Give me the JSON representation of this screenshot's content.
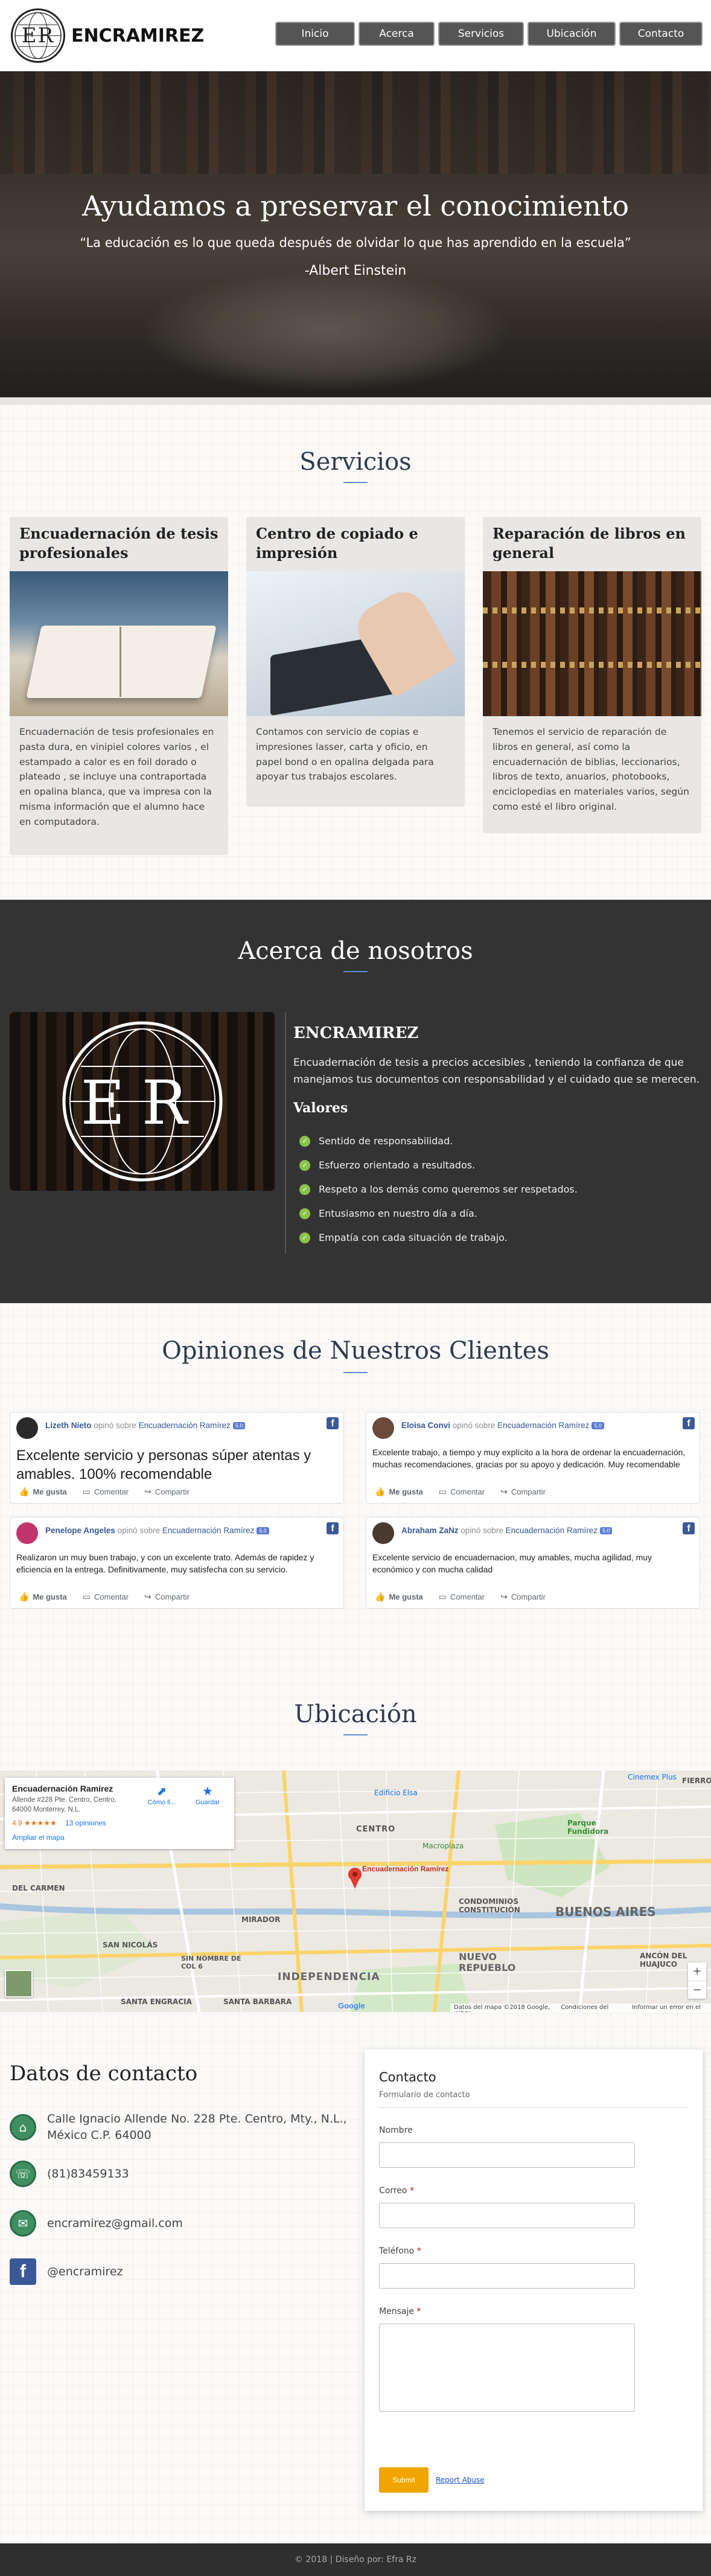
{
  "header": {
    "logo_text": "ER",
    "brand": "ENCRAMIREZ",
    "nav": [
      "Inicio",
      "Acerca",
      "Servicios",
      "Ubicación",
      "Contacto"
    ]
  },
  "hero": {
    "title": "Ayudamos a preservar el conocimiento",
    "quote": "“La educación es lo que queda después de olvidar lo que has aprendido en la escuela”",
    "author": "-Albert Einstein"
  },
  "services": {
    "title": "Servicios",
    "cards": [
      {
        "title": "Encuadernación de tesis profesionales",
        "text": "Encuadernación de tesis profesionales en pasta dura, en vinipiel colores varios , el estampado a calor es en foil dorado o plateado , se incluye una contraportada en opalina blanca, que va impresa con la misma información que el alumno hace en computadora."
      },
      {
        "title": "Centro de copiado e impresión",
        "text": "Contamos con servicio de copias e impresiones lasser, carta y oficio, en papel bond o en opalina delgada para apoyar tus trabajos escolares."
      },
      {
        "title": "Reparación de libros en general",
        "text": "Tenemos el servicio de reparación de libros en general, así como la encuadernación de biblias, leccionarios, libros de texto, anuarios, photobooks, enciclopedias en materiales varios, según como esté el libro original."
      }
    ]
  },
  "about": {
    "title": "Acerca de nosotros",
    "logo_text": "ER",
    "brand": "ENCRAMIREZ",
    "description": "Encuadernación de tesis a precios accesibles , teniendo la confianza de que manejamos tus documentos con responsabilidad y el cuidado que se merecen.",
    "values_title": "Valores",
    "values": [
      "Sentido de responsabilidad.",
      "Esfuerzo orientado a resultados.",
      "Respeto a los demás como queremos ser respetados.",
      "Entusiasmo en nuestro día a día.",
      "Empatía con cada situación de trabajo."
    ]
  },
  "opinions": {
    "title": "Opiniones de Nuestros Clientes",
    "verb": "opinó sobre",
    "page": "Encuadernación Ramírez",
    "badge": "5.0",
    "fb_icon": "f",
    "actions": [
      "Me gusta",
      "Comentar",
      "Compartir"
    ],
    "reviews": [
      {
        "name": "Lizeth Nieto",
        "text": "Excelente servicio y personas súper atentas y amables. 100% recomendable",
        "avatar_color": "#2a2a2a"
      },
      {
        "name": "Eloisa Convi",
        "text": "Excelente trabajo, a tiempo y muy explícito a la hora de ordenar la encuadernación, muchas recomendaciones, gracias por su apoyo y dedicación. Muy recomendable",
        "avatar_color": "#6b4a3a"
      },
      {
        "name": "Penelope Angeles",
        "text": "Realizaron un muy buen trabajo, y con un excelente trato. Además de rapidez y eficiencia en la entrega. Definitivamente, muy satisfecha con su servicio.",
        "avatar_color": "#c0356a"
      },
      {
        "name": "Abraham ZaNz",
        "text": "Excelente servicio de encuadernacion, muy amables, mucha agilidad, muy económico y con mucha calidad",
        "avatar_color": "#4a3a30"
      }
    ]
  },
  "location": {
    "title": "Ubicación",
    "place_name": "Encuadernación Ramírez",
    "address": "Allende #228 Pte. Centro, Centro, 64000 Monterrey, N.L.",
    "rating": "4.9",
    "stars": "★★★★★",
    "reviews_link": "13 opiniones",
    "enlarge": "Ampliar el mapa",
    "directions": "Cómo ll...",
    "save": "Guardar",
    "marker_label": "Encuadernación Ramírez",
    "map_labels": [
      "CENTRO",
      "DEL CARMEN",
      "CONDOMINIOS CONSTITUCIÓN",
      "BUENOS AIRES",
      "INDEPENDENCIA",
      "NUEVO REPUEBLO",
      "SAN NICOLÁS",
      "MIRADOR",
      "SIN NOMBRE DE COL 6",
      "SANTA ENGRACIA",
      "SANTA BARBARA",
      "ANCÓN DEL HUAJUCO",
      "FIERRO",
      "Parque Fundidora",
      "Edificio Elsa",
      "Cinemex Plus",
      "Macroplaza"
    ],
    "google": "Google",
    "attribution": "Datos del mapa ©2018 Google, INEGI",
    "terms": "Condiciones del servicio",
    "report": "Informar un error en el mapa",
    "zoom_in": "+",
    "zoom_out": "−"
  },
  "contact": {
    "title": "Datos de contacto",
    "items": [
      {
        "icon": "home-icon",
        "text": "Calle Ignacio Allende No. 228 Pte. Centro, Mty., N.L., México C.P. 64000"
      },
      {
        "icon": "phone-icon",
        "text": "(81)83459133"
      },
      {
        "icon": "email-icon",
        "text": "encramirez@gmail.com"
      },
      {
        "icon": "facebook-icon",
        "text": "@encramirez"
      }
    ],
    "form": {
      "title": "Contacto",
      "subtitle": "Formulario de contacto",
      "name_label": "Nombre",
      "email_label": "Correo",
      "phone_label": "Teléfono",
      "message_label": "Mensaje",
      "required_mark": "*",
      "submit": "Submit",
      "report_abuse": "Report Abuse"
    }
  },
  "footer": {
    "text": "© 2018 | Diseño por: Efra Rz"
  }
}
